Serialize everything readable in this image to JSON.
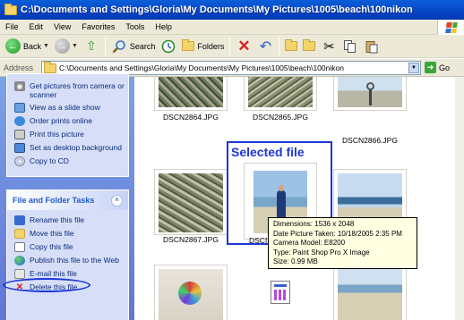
{
  "window": {
    "title": "C:\\Documents and Settings\\Gloria\\My Documents\\My Pictures\\1005\\beach\\100nikon",
    "logo_icon": "windows-xp-flag-icon"
  },
  "menu": {
    "items": [
      "File",
      "Edit",
      "View",
      "Favorites",
      "Tools",
      "Help"
    ]
  },
  "toolbar": {
    "back_label": "Back",
    "search_label": "Search",
    "folders_label": "Folders"
  },
  "address": {
    "label": "Address",
    "value": "C:\\Documents and Settings\\Gloria\\My Documents\\My Pictures\\1005\\beach\\100nikon",
    "go_label": "Go"
  },
  "picture_tasks": {
    "items": [
      {
        "label": "Get pictures from camera or scanner",
        "icon": "camera-icon"
      },
      {
        "label": "View as a slide show",
        "icon": "slideshow-icon"
      },
      {
        "label": "Order prints online",
        "icon": "order-prints-icon"
      },
      {
        "label": "Print this picture",
        "icon": "printer-icon"
      },
      {
        "label": "Set as desktop background",
        "icon": "desktop-icon"
      },
      {
        "label": "Copy to CD",
        "icon": "cd-icon"
      }
    ]
  },
  "file_tasks": {
    "header": "File and Folder Tasks",
    "items": [
      {
        "label": "Rename this file",
        "icon": "rename-icon"
      },
      {
        "label": "Move this file",
        "icon": "move-icon"
      },
      {
        "label": "Copy this file",
        "icon": "copy-icon"
      },
      {
        "label": "Publish this file to the Web",
        "icon": "globe-icon"
      },
      {
        "label": "E-mail this file",
        "icon": "email-icon"
      },
      {
        "label": "Delete this file",
        "icon": "delete-icon"
      }
    ]
  },
  "files": [
    {
      "name": "DSCN2864.JPG"
    },
    {
      "name": "DSCN2865.JPG"
    },
    {
      "name": "DSCN2866.JPG"
    },
    {
      "name": "DSCN2867.JPG"
    },
    {
      "name": "DSCN2868.JPG"
    }
  ],
  "annotation": {
    "selected_label": "Selected file"
  },
  "tooltip": {
    "dimensions": "Dimensions: 1536 x 2048",
    "date_taken": "Date Picture Taken: 10/18/2005 2:35 PM",
    "camera": "Camera Model: E8200",
    "type": "Type: Paint Shop Pro X Image",
    "size": "Size: 0.99 MB"
  }
}
